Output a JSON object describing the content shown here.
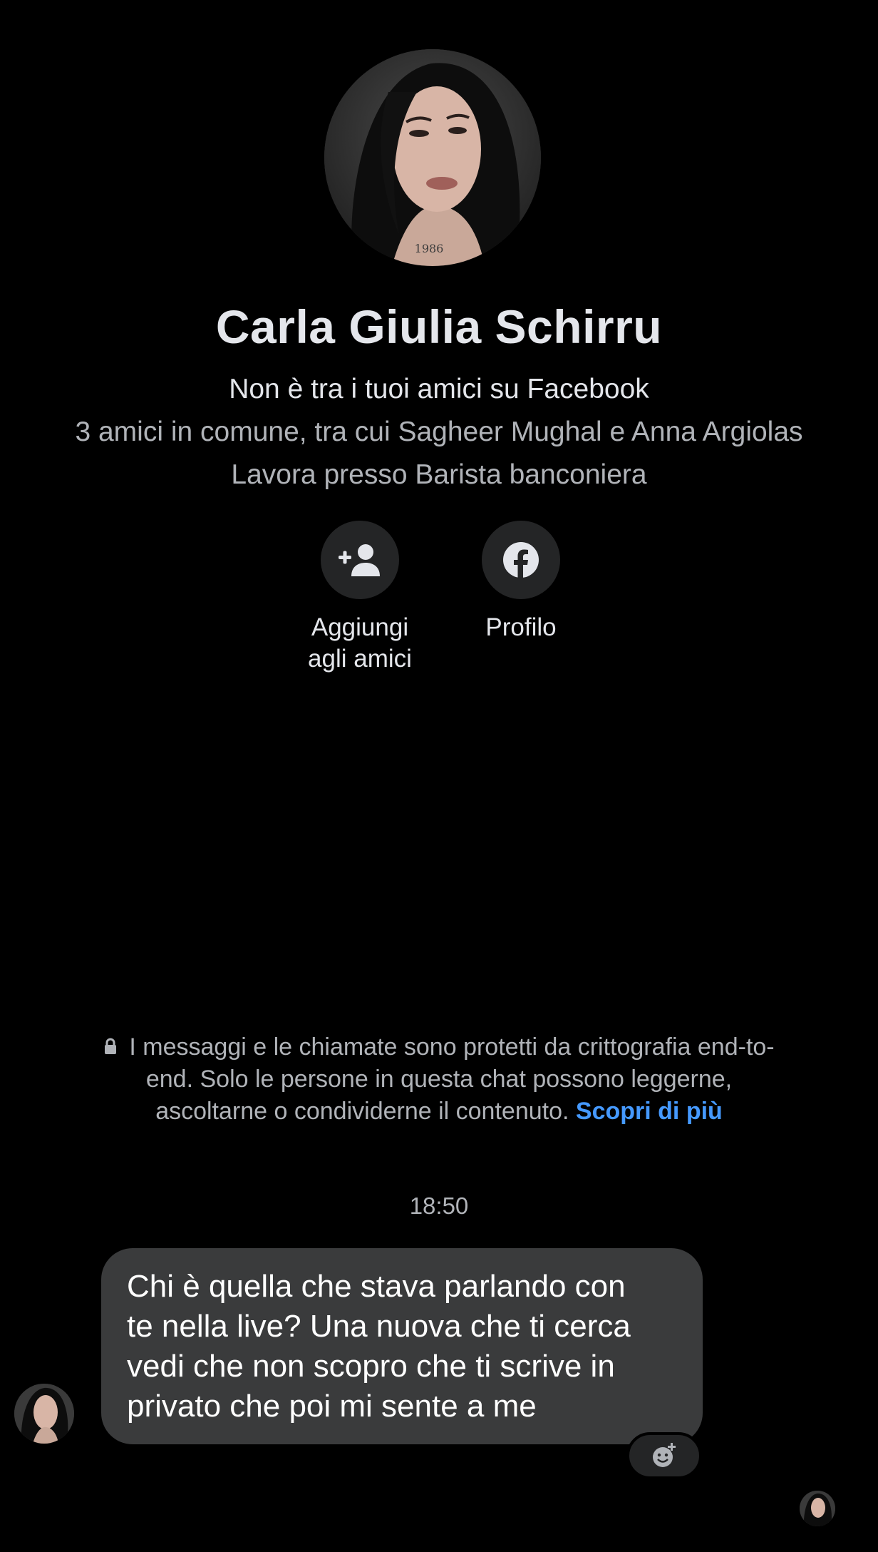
{
  "profile": {
    "name": "Carla Giulia Schirru",
    "avatar_tattoo_text": "1986",
    "friend_status": "Non è tra i tuoi amici su Facebook",
    "mutual_friends": "3 amici in comune, tra cui Sagheer Mughal e Anna Argiolas",
    "work": "Lavora presso Barista banconiera"
  },
  "actions": {
    "add_friend": {
      "icon": "add-friend-icon",
      "label": "Aggiungi\nagli amici"
    },
    "profile": {
      "icon": "facebook-icon",
      "label": "Profilo"
    }
  },
  "encryption": {
    "icon": "lock-icon",
    "text": "I messaggi e le chiamate sono protetti da crittografia end-to-end. Solo le persone in questa chat possono leggerne, ascoltarne o condividerne il contenuto.",
    "link": "Scopri di più"
  },
  "conversation": {
    "timestamp": "18:50",
    "messages": [
      {
        "text": "Chi è quella  che stava parlando con\nte nella live? Una nuova che ti cerca\nvedi che non scopro che ti scrive in\nprivato che poi mi sente a me"
      }
    ],
    "reaction_icon": "add-reaction-icon"
  },
  "colors": {
    "background": "#000000",
    "bubble": "#3a3b3c",
    "link": "#4599ff",
    "secondary_text": "#b0b3b8",
    "action_circle": "#242526"
  }
}
